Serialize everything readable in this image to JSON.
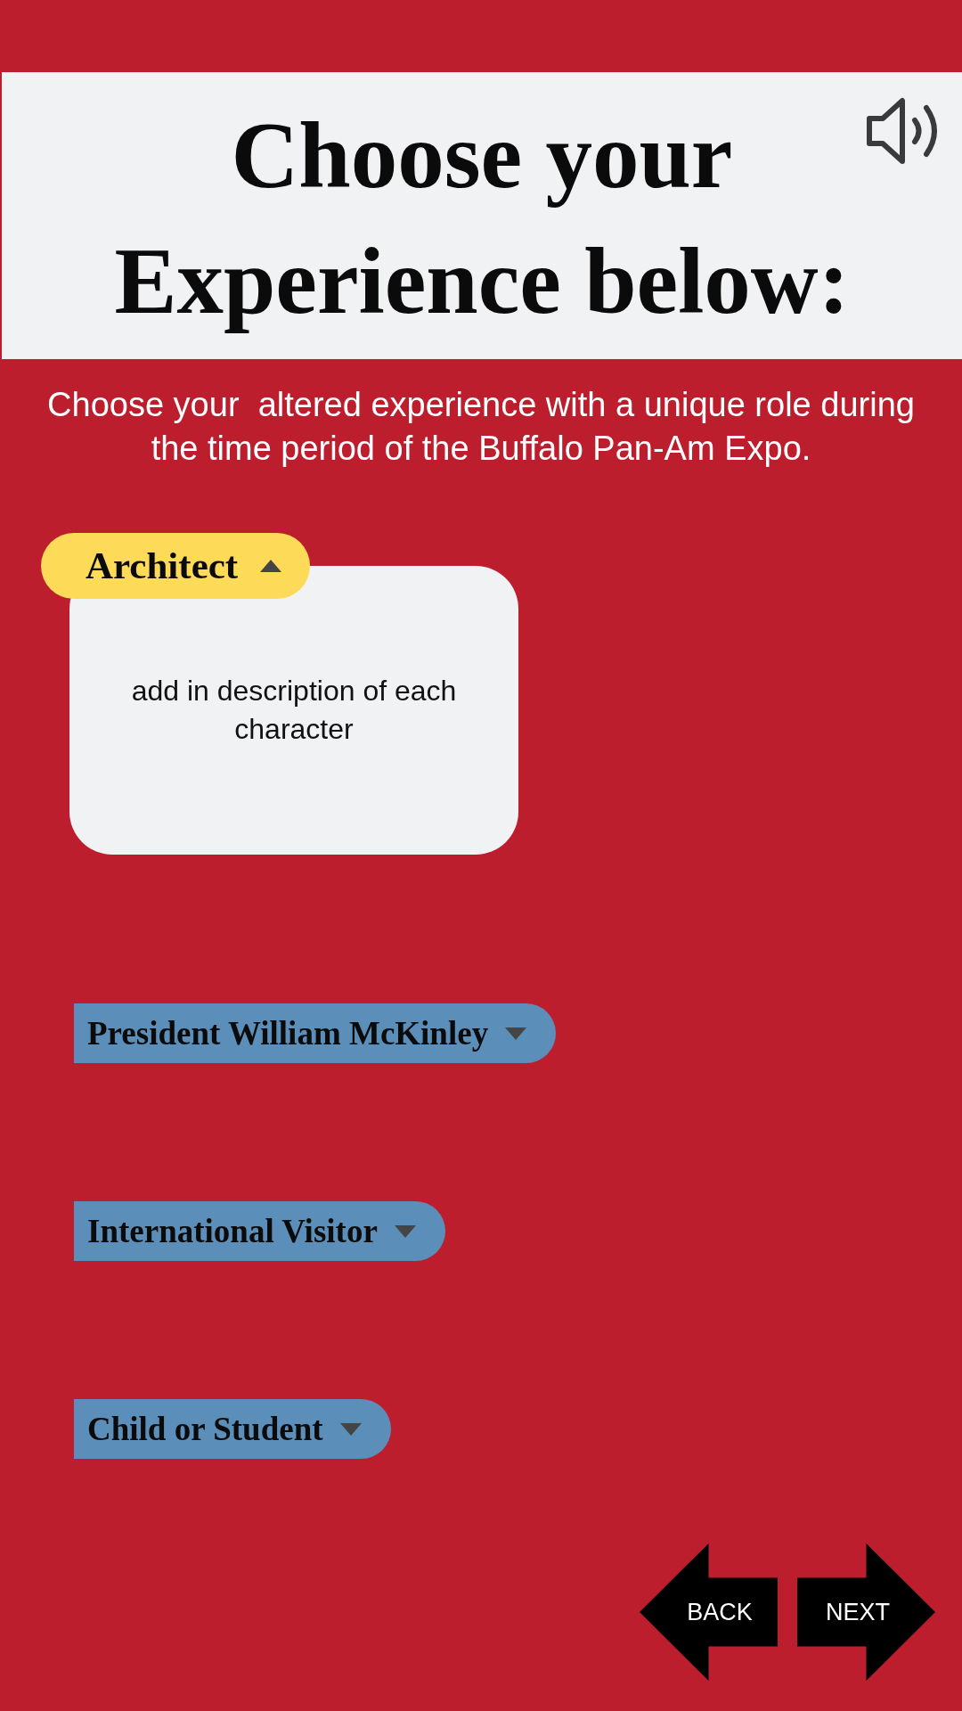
{
  "header": {
    "title": "Choose your Experience below:"
  },
  "subtitle": "Choose your  altered experience with a unique role during the time period of the Buffalo Pan-Am Expo.",
  "roles": [
    {
      "label": "Architect",
      "expanded": true,
      "description": "add in description of each character"
    },
    {
      "label": "President William McKinley",
      "expanded": false
    },
    {
      "label": "International Visitor",
      "expanded": false
    },
    {
      "label": "Child or Student",
      "expanded": false
    }
  ],
  "nav": [
    {
      "label": "BACK",
      "kind": "back"
    },
    {
      "label": "NEXT",
      "kind": "next"
    }
  ]
}
